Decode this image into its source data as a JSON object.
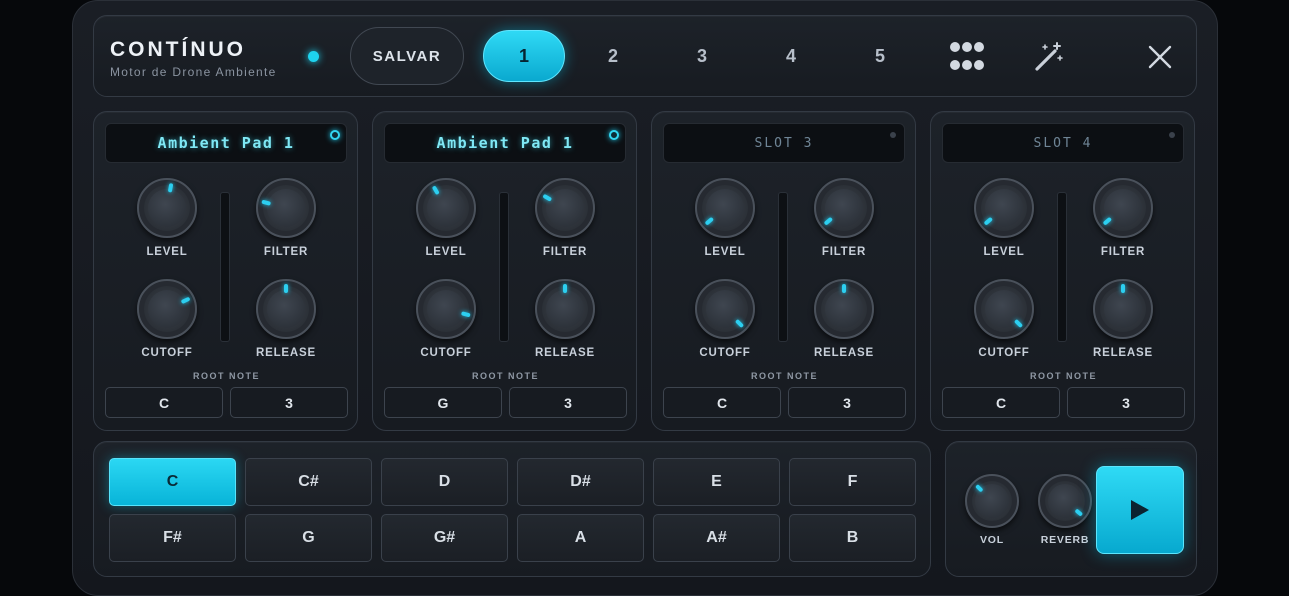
{
  "header": {
    "title": "CONTÍNUO",
    "subtitle": "Motor de Drone Ambiente",
    "save_label": "SALVAR",
    "tabs": [
      "1",
      "2",
      "3",
      "4",
      "5"
    ],
    "active_tab": "1",
    "icons": [
      "grid-icon",
      "magic-wand-icon",
      "close-icon"
    ]
  },
  "slots": [
    {
      "name": "Ambient Pad 1",
      "active": true,
      "knobs": [
        {
          "label": "LEVEL",
          "angle": 10
        },
        {
          "label": "FILTER",
          "angle": -75
        },
        {
          "label": "CUTOFF",
          "angle": 65
        },
        {
          "label": "RELEASE",
          "angle": 0
        }
      ],
      "root_note_label": "ROOT NOTE",
      "root_note": "C",
      "octave": "3"
    },
    {
      "name": "Ambient Pad 1",
      "active": true,
      "knobs": [
        {
          "label": "LEVEL",
          "angle": -30
        },
        {
          "label": "FILTER",
          "angle": -60
        },
        {
          "label": "CUTOFF",
          "angle": 105
        },
        {
          "label": "RELEASE",
          "angle": 0
        }
      ],
      "root_note_label": "ROOT NOTE",
      "root_note": "G",
      "octave": "3"
    },
    {
      "name": "SLOT 3",
      "active": false,
      "knobs": [
        {
          "label": "LEVEL",
          "angle": -130
        },
        {
          "label": "FILTER",
          "angle": -130
        },
        {
          "label": "CUTOFF",
          "angle": 135
        },
        {
          "label": "RELEASE",
          "angle": 0
        }
      ],
      "root_note_label": "ROOT NOTE",
      "root_note": "C",
      "octave": "3"
    },
    {
      "name": "SLOT 4",
      "active": false,
      "knobs": [
        {
          "label": "LEVEL",
          "angle": -130
        },
        {
          "label": "FILTER",
          "angle": -130
        },
        {
          "label": "CUTOFF",
          "angle": 135
        },
        {
          "label": "RELEASE",
          "angle": 0
        }
      ],
      "root_note_label": "ROOT NOTE",
      "root_note": "C",
      "octave": "3"
    }
  ],
  "notes": {
    "keys": [
      "C",
      "C#",
      "D",
      "D#",
      "E",
      "F",
      "F#",
      "G",
      "G#",
      "A",
      "A#",
      "B"
    ],
    "selected": "C"
  },
  "transport": {
    "vol_label": "VOL",
    "vol_angle": -45,
    "reverb_label": "REVERB",
    "reverb_angle": 130,
    "play_icon": "play-icon"
  },
  "colors": {
    "accent": "#1ed3ef",
    "background": "#14171d"
  }
}
